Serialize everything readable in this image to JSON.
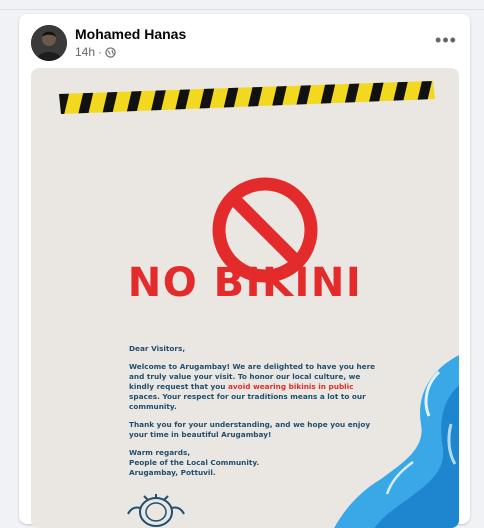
{
  "post": {
    "author": "Mohamed Hanas",
    "time": "14h",
    "separator": "·",
    "privacy_icon": "globe-icon",
    "more_icon": "more-horizontal-icon",
    "more_label": "•••"
  },
  "notice": {
    "headline": "NO BIKINI",
    "greeting": "Dear Visitors,",
    "para1_before": "Welcome to Arugambay! We are delighted to have you here and truly value your visit. To honor our local culture, we kindly request that you ",
    "para1_highlight": "avoid wearing bikinis in public",
    "para1_after": " spaces. Your respect for our traditions means a lot to our community.",
    "para2": "Thank you for your understanding, and we hope you enjoy your time in beautiful Arugambay!",
    "closing_line1": "Warm regards,",
    "closing_line2": "People of the Local Community.",
    "closing_line3": "Arugambay, Pottuvil."
  },
  "colors": {
    "accent_red": "#e42b2b",
    "letter_blue": "#1f4e6e",
    "tape_yellow": "#f2d81e",
    "wave_blue": "#3aa7e6"
  }
}
